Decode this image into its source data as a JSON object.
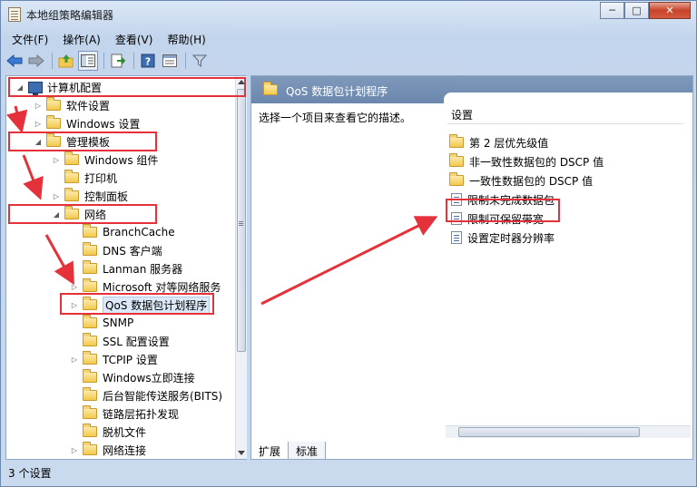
{
  "window": {
    "title": "本地组策略编辑器",
    "buttons": {
      "minimize": "─",
      "maximize": "□",
      "close": "✕"
    }
  },
  "menu": [
    {
      "label": "文件(F)"
    },
    {
      "label": "操作(A)"
    },
    {
      "label": "查看(V)"
    },
    {
      "label": "帮助(H)"
    }
  ],
  "toolbar": [
    {
      "icon": "back-arrow-icon",
      "glyph": "⇦"
    },
    {
      "icon": "forward-arrow-icon",
      "glyph": "⇨"
    },
    {
      "icon": "up-folder-icon",
      "glyph": "▲"
    },
    {
      "icon": "show-hide-tree-icon",
      "glyph": "▥"
    },
    {
      "icon": "export-list-icon",
      "glyph": "⇥"
    },
    {
      "icon": "help-icon",
      "glyph": "?"
    },
    {
      "icon": "properties-icon",
      "glyph": "▤"
    },
    {
      "icon": "filter-icon",
      "glyph": "⊽"
    }
  ],
  "tree": [
    {
      "label": "计算机配置",
      "expander": "◢",
      "icon": "computer-icon"
    },
    {
      "label": "软件设置",
      "expander": "▷",
      "icon": "folder-icon"
    },
    {
      "label": "Windows 设置",
      "expander": "▷",
      "icon": "folder-icon"
    },
    {
      "label": "管理模板",
      "expander": "◢",
      "icon": "folder-icon"
    },
    {
      "label": "Windows 组件",
      "expander": "▷",
      "icon": "folder-icon"
    },
    {
      "label": "打印机",
      "expander": "",
      "icon": "folder-icon"
    },
    {
      "label": "控制面板",
      "expander": "▷",
      "icon": "folder-icon"
    },
    {
      "label": "网络",
      "expander": "◢",
      "icon": "folder-icon"
    },
    {
      "label": "BranchCache",
      "expander": "",
      "icon": "folder-icon"
    },
    {
      "label": "DNS 客户端",
      "expander": "",
      "icon": "folder-icon"
    },
    {
      "label": "Lanman 服务器",
      "expander": "",
      "icon": "folder-icon"
    },
    {
      "label": "Microsoft 对等网络服务",
      "expander": "▷",
      "icon": "folder-icon"
    },
    {
      "label": "QoS 数据包计划程序",
      "expander": "▷",
      "icon": "folder-icon"
    },
    {
      "label": "SNMP",
      "expander": "",
      "icon": "folder-icon"
    },
    {
      "label": "SSL 配置设置",
      "expander": "",
      "icon": "folder-icon"
    },
    {
      "label": "TCPIP 设置",
      "expander": "▷",
      "icon": "folder-icon"
    },
    {
      "label": "Windows立即连接",
      "expander": "",
      "icon": "folder-icon"
    },
    {
      "label": "后台智能传送服务(BITS)",
      "expander": "",
      "icon": "folder-icon"
    },
    {
      "label": "链路层拓扑发现",
      "expander": "",
      "icon": "folder-icon"
    },
    {
      "label": "脱机文件",
      "expander": "",
      "icon": "folder-icon"
    },
    {
      "label": "网络连接",
      "expander": "▷",
      "icon": "folder-icon"
    }
  ],
  "right_pane": {
    "header_title": "QoS 数据包计划程序",
    "description": "选择一个项目来查看它的描述。",
    "column_header": "设置",
    "items": [
      {
        "label": "第 2 层优先级值",
        "icon": "folder-icon"
      },
      {
        "label": "非一致性数据包的 DSCP 值",
        "icon": "folder-icon"
      },
      {
        "label": "一致性数据包的 DSCP 值",
        "icon": "folder-icon"
      },
      {
        "label": "限制未完成数据包",
        "icon": "policy-setting-icon"
      },
      {
        "label": "限制可保留带宽",
        "icon": "policy-setting-icon"
      },
      {
        "label": "设置定时器分辨率",
        "icon": "policy-setting-icon"
      }
    ]
  },
  "tabs": [
    {
      "label": "扩展"
    },
    {
      "label": "标准"
    }
  ],
  "status": {
    "text": "3 个设置"
  },
  "colors": {
    "highlight_box": "#e5323a",
    "header_bar": "#6b87ad"
  }
}
